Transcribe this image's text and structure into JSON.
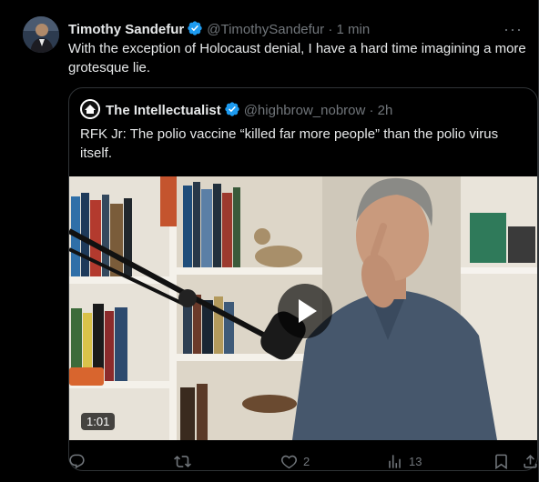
{
  "tweet": {
    "author_name": "Timothy Sandefur",
    "author_handle": "@TimothySandefur",
    "time": "· 1 min",
    "text": "With the exception of Holocaust denial, I have a hard time imagining a more grotesque lie.",
    "more_label": "···"
  },
  "quote": {
    "author_name": "The Intellectualist",
    "author_handle": "@highbrow_nobrow",
    "time": "· 2h",
    "text": "RFK Jr: The polio vaccine “killed far more people” than the polio virus itself.",
    "video_duration": "1:01"
  },
  "actions": {
    "likes": "2",
    "views": "13"
  },
  "colors": {
    "verified": "#1d9bf0",
    "muted": "#71767b",
    "border": "#2f3336"
  }
}
